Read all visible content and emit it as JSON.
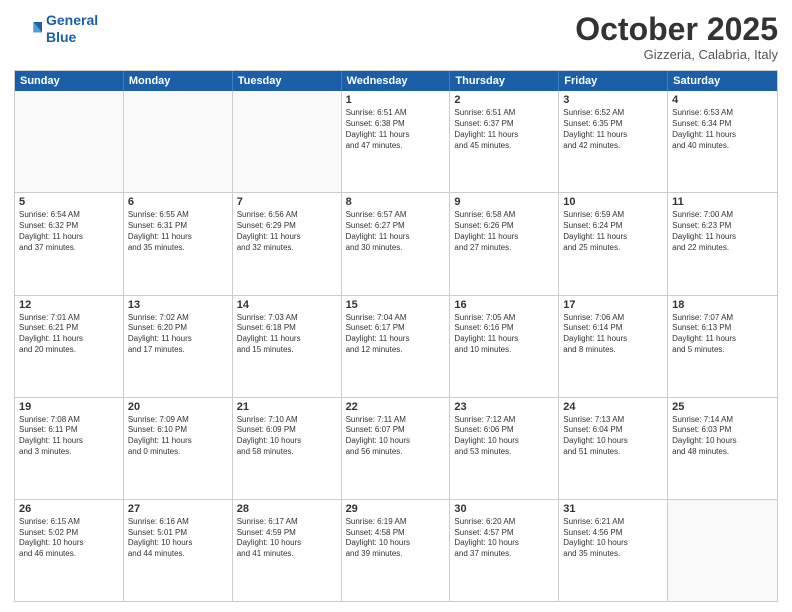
{
  "header": {
    "logo_line1": "General",
    "logo_line2": "Blue",
    "month": "October 2025",
    "location": "Gizzeria, Calabria, Italy"
  },
  "weekdays": [
    "Sunday",
    "Monday",
    "Tuesday",
    "Wednesday",
    "Thursday",
    "Friday",
    "Saturday"
  ],
  "rows": [
    [
      {
        "day": "",
        "text": ""
      },
      {
        "day": "",
        "text": ""
      },
      {
        "day": "",
        "text": ""
      },
      {
        "day": "1",
        "text": "Sunrise: 6:51 AM\nSunset: 6:38 PM\nDaylight: 11 hours\nand 47 minutes."
      },
      {
        "day": "2",
        "text": "Sunrise: 6:51 AM\nSunset: 6:37 PM\nDaylight: 11 hours\nand 45 minutes."
      },
      {
        "day": "3",
        "text": "Sunrise: 6:52 AM\nSunset: 6:35 PM\nDaylight: 11 hours\nand 42 minutes."
      },
      {
        "day": "4",
        "text": "Sunrise: 6:53 AM\nSunset: 6:34 PM\nDaylight: 11 hours\nand 40 minutes."
      }
    ],
    [
      {
        "day": "5",
        "text": "Sunrise: 6:54 AM\nSunset: 6:32 PM\nDaylight: 11 hours\nand 37 minutes."
      },
      {
        "day": "6",
        "text": "Sunrise: 6:55 AM\nSunset: 6:31 PM\nDaylight: 11 hours\nand 35 minutes."
      },
      {
        "day": "7",
        "text": "Sunrise: 6:56 AM\nSunset: 6:29 PM\nDaylight: 11 hours\nand 32 minutes."
      },
      {
        "day": "8",
        "text": "Sunrise: 6:57 AM\nSunset: 6:27 PM\nDaylight: 11 hours\nand 30 minutes."
      },
      {
        "day": "9",
        "text": "Sunrise: 6:58 AM\nSunset: 6:26 PM\nDaylight: 11 hours\nand 27 minutes."
      },
      {
        "day": "10",
        "text": "Sunrise: 6:59 AM\nSunset: 6:24 PM\nDaylight: 11 hours\nand 25 minutes."
      },
      {
        "day": "11",
        "text": "Sunrise: 7:00 AM\nSunset: 6:23 PM\nDaylight: 11 hours\nand 22 minutes."
      }
    ],
    [
      {
        "day": "12",
        "text": "Sunrise: 7:01 AM\nSunset: 6:21 PM\nDaylight: 11 hours\nand 20 minutes."
      },
      {
        "day": "13",
        "text": "Sunrise: 7:02 AM\nSunset: 6:20 PM\nDaylight: 11 hours\nand 17 minutes."
      },
      {
        "day": "14",
        "text": "Sunrise: 7:03 AM\nSunset: 6:18 PM\nDaylight: 11 hours\nand 15 minutes."
      },
      {
        "day": "15",
        "text": "Sunrise: 7:04 AM\nSunset: 6:17 PM\nDaylight: 11 hours\nand 12 minutes."
      },
      {
        "day": "16",
        "text": "Sunrise: 7:05 AM\nSunset: 6:16 PM\nDaylight: 11 hours\nand 10 minutes."
      },
      {
        "day": "17",
        "text": "Sunrise: 7:06 AM\nSunset: 6:14 PM\nDaylight: 11 hours\nand 8 minutes."
      },
      {
        "day": "18",
        "text": "Sunrise: 7:07 AM\nSunset: 6:13 PM\nDaylight: 11 hours\nand 5 minutes."
      }
    ],
    [
      {
        "day": "19",
        "text": "Sunrise: 7:08 AM\nSunset: 6:11 PM\nDaylight: 11 hours\nand 3 minutes."
      },
      {
        "day": "20",
        "text": "Sunrise: 7:09 AM\nSunset: 6:10 PM\nDaylight: 11 hours\nand 0 minutes."
      },
      {
        "day": "21",
        "text": "Sunrise: 7:10 AM\nSunset: 6:09 PM\nDaylight: 10 hours\nand 58 minutes."
      },
      {
        "day": "22",
        "text": "Sunrise: 7:11 AM\nSunset: 6:07 PM\nDaylight: 10 hours\nand 56 minutes."
      },
      {
        "day": "23",
        "text": "Sunrise: 7:12 AM\nSunset: 6:06 PM\nDaylight: 10 hours\nand 53 minutes."
      },
      {
        "day": "24",
        "text": "Sunrise: 7:13 AM\nSunset: 6:04 PM\nDaylight: 10 hours\nand 51 minutes."
      },
      {
        "day": "25",
        "text": "Sunrise: 7:14 AM\nSunset: 6:03 PM\nDaylight: 10 hours\nand 48 minutes."
      }
    ],
    [
      {
        "day": "26",
        "text": "Sunrise: 6:15 AM\nSunset: 5:02 PM\nDaylight: 10 hours\nand 46 minutes."
      },
      {
        "day": "27",
        "text": "Sunrise: 6:16 AM\nSunset: 5:01 PM\nDaylight: 10 hours\nand 44 minutes."
      },
      {
        "day": "28",
        "text": "Sunrise: 6:17 AM\nSunset: 4:59 PM\nDaylight: 10 hours\nand 41 minutes."
      },
      {
        "day": "29",
        "text": "Sunrise: 6:19 AM\nSunset: 4:58 PM\nDaylight: 10 hours\nand 39 minutes."
      },
      {
        "day": "30",
        "text": "Sunrise: 6:20 AM\nSunset: 4:57 PM\nDaylight: 10 hours\nand 37 minutes."
      },
      {
        "day": "31",
        "text": "Sunrise: 6:21 AM\nSunset: 4:56 PM\nDaylight: 10 hours\nand 35 minutes."
      },
      {
        "day": "",
        "text": ""
      }
    ]
  ]
}
